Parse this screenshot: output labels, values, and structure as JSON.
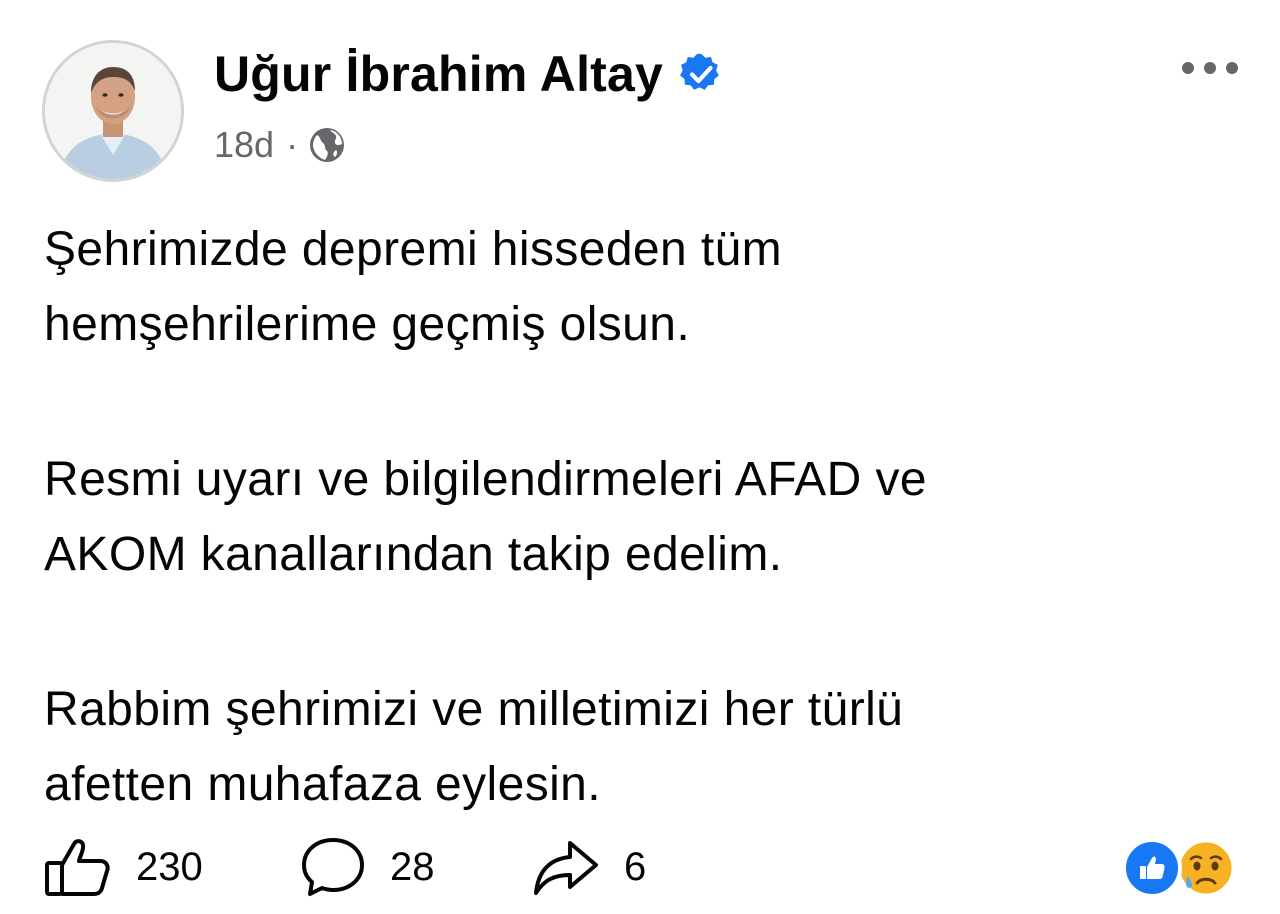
{
  "post": {
    "author": {
      "name": "Uğur İbrahim Altay",
      "verified": true,
      "avatar_icon": "profile-photo"
    },
    "timestamp": "18d",
    "separator": "·",
    "audience_icon": "globe-icon",
    "body": [
      "Şehrimizde depremi hisseden tüm\nhemşehrilerime geçmiş olsun.",
      "Resmi uyarı ve bilgilendirmeleri AFAD ve\nAKOM kanallarından takip edelim.",
      "Rabbim şehrimizi ve milletimizi her türlü\nafetten muhafaza eylesin."
    ],
    "actions": {
      "like_count": "230",
      "comment_count": "28",
      "share_count": "6"
    },
    "reactions": [
      "like",
      "sad"
    ],
    "colors": {
      "accent": "#1877f2",
      "secondary_text": "#65676b",
      "text": "#050505"
    }
  }
}
